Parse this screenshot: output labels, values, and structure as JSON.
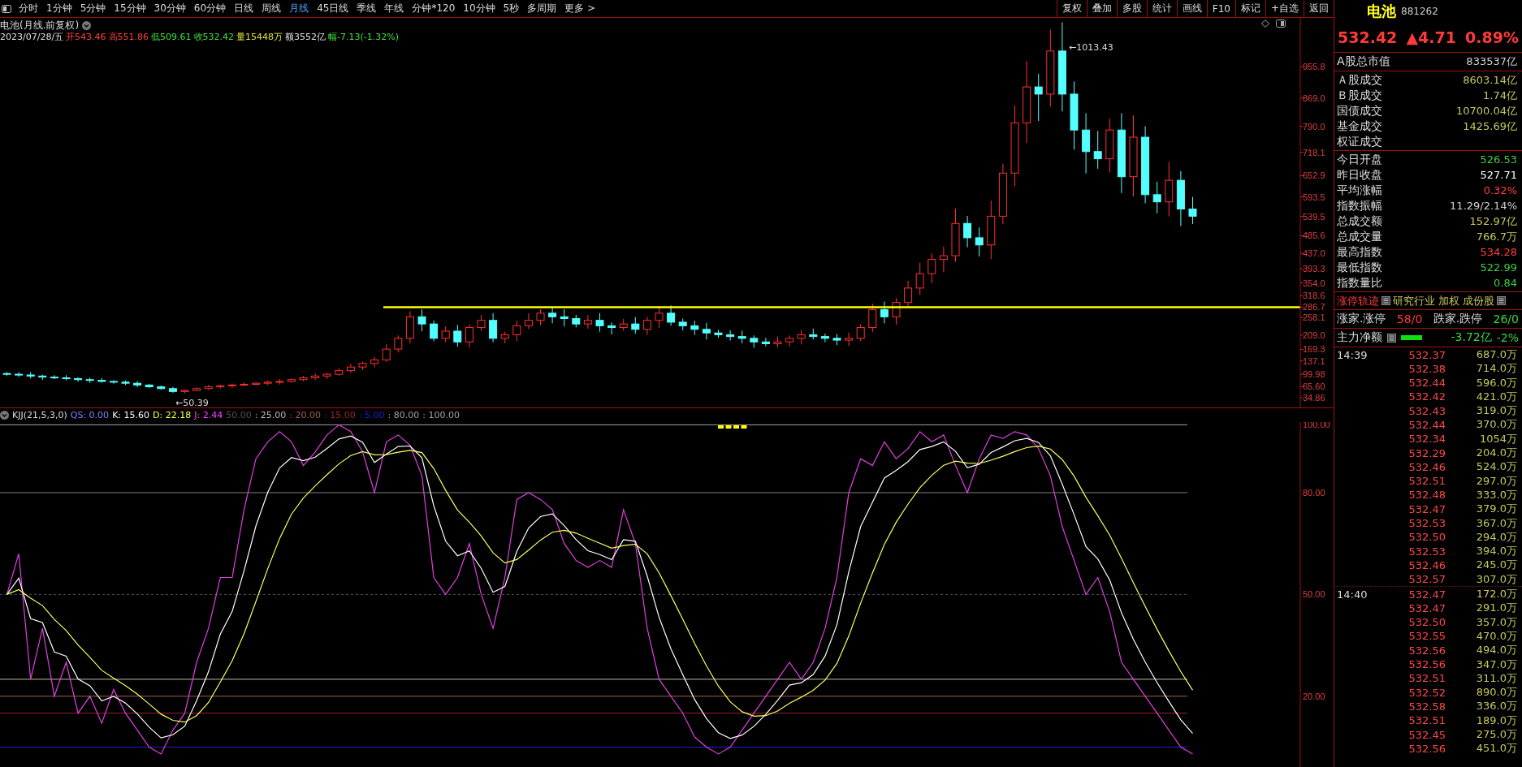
{
  "toolbar": {
    "periods": [
      {
        "label": "分时",
        "selected": false
      },
      {
        "label": "1分钟",
        "selected": false
      },
      {
        "label": "5分钟",
        "selected": false
      },
      {
        "label": "15分钟",
        "selected": false
      },
      {
        "label": "30分钟",
        "selected": false
      },
      {
        "label": "60分钟",
        "selected": false
      },
      {
        "label": "日线",
        "selected": false
      },
      {
        "label": "周线",
        "selected": false
      },
      {
        "label": "月线",
        "selected": true
      },
      {
        "label": "45日线",
        "selected": false
      },
      {
        "label": "季线",
        "selected": false
      },
      {
        "label": "年线",
        "selected": false
      },
      {
        "label": "分钟*120",
        "selected": false
      },
      {
        "label": "10分钟",
        "selected": false
      },
      {
        "label": "5秒",
        "selected": false
      },
      {
        "label": "多周期",
        "selected": false
      },
      {
        "label": "更多 >",
        "selected": false
      }
    ],
    "actions": [
      "复权",
      "叠加",
      "多股",
      "统计",
      "画线",
      "F10",
      "标记",
      "+自选",
      "返回"
    ]
  },
  "chart": {
    "title": "电池(月线.前复权)",
    "quote": [
      {
        "text": "2023/07/28/五",
        "color": "#e0e0e0"
      },
      {
        "text": "开543.46",
        "color": "#ff4040"
      },
      {
        "text": "高551.86",
        "color": "#ff4040"
      },
      {
        "text": "低509.61",
        "color": "#40e040"
      },
      {
        "text": "收532.42",
        "color": "#40e040"
      },
      {
        "text": "量15448万",
        "color": "#e0e040"
      },
      {
        "text": "额3552亿",
        "color": "#e0e0e0"
      },
      {
        "text": "幅-7.13(-1.32%)",
        "color": "#40e040"
      }
    ],
    "price_ticks": [
      "955.8",
      "869.0",
      "790.0",
      "718.1",
      "652.9",
      "593.5",
      "539.5",
      "485.6",
      "437.0",
      "393.3",
      "354.0",
      "318.6",
      "286.7",
      "258.1",
      "209.0",
      "169.3",
      "137.1",
      "99.98",
      "65.60",
      "34.86"
    ],
    "high_label": "←1013.43",
    "low_label": "←50.39"
  },
  "indicator": {
    "name": "KJJ(21,5,3,0)",
    "values": [
      {
        "text": "QS: 0.00",
        "color": "#8080ff"
      },
      {
        "text": "K: 15.60",
        "color": "#ffffff"
      },
      {
        "text": "D: 22.18",
        "color": "#ffff40"
      },
      {
        "text": "J: 2.44",
        "color": "#ff40ff"
      },
      {
        "text": "50.00",
        "color": "#505050"
      },
      {
        "text": ": 25.00",
        "color": "#c8b8a8"
      },
      {
        "text": ": 20.00",
        "color": "#a06050"
      },
      {
        "text": ": 15.00",
        "color": "#a02030"
      },
      {
        "text": ": 5.00",
        "color": "#2020d0"
      },
      {
        "text": ": 80.00",
        "color": "#a0a0a0"
      },
      {
        "text": ": 100.00",
        "color": "#a0a0a0"
      }
    ],
    "ticks": [
      "100.00",
      "80.00",
      "50.00",
      "20.00"
    ]
  },
  "quote_panel": {
    "name": "电池",
    "code": "881262",
    "price": "532.42",
    "change": "▲4.71",
    "percent": "0.89%",
    "market_cap": {
      "label": "A股总市值",
      "value": "833537亿",
      "color": "#d0d0d0"
    },
    "groups": [
      [
        {
          "label": "Ａ股成交",
          "value": "8603.14亿",
          "color": "#c8c860"
        },
        {
          "label": "Ｂ股成交",
          "value": "1.74亿",
          "color": "#c8c860"
        },
        {
          "label": "国债成交",
          "value": "10700.04亿",
          "color": "#c8c860"
        },
        {
          "label": "基金成交",
          "value": "1425.69亿",
          "color": "#c8c860"
        },
        {
          "label": "权证成交"
        }
      ],
      [
        {
          "label": "今日开盘",
          "value": "526.53",
          "color": "#40d040"
        },
        {
          "label": "昨日收盘",
          "value": "527.71",
          "color": "#ffffff"
        },
        {
          "label": "平均涨幅",
          "value": "0.32%",
          "color": "#ff4040"
        },
        {
          "label": "指数振幅",
          "value": "11.29/2.14%",
          "color": "#d0d0d0"
        },
        {
          "label": "总成交额",
          "value": "152.97亿",
          "color": "#c8c860"
        },
        {
          "label": "总成交量",
          "value": "766.7万",
          "color": "#c8c860"
        },
        {
          "label": "最高指数",
          "value": "534.28",
          "color": "#ff4040"
        },
        {
          "label": "最低指数",
          "value": "522.99",
          "color": "#40d040"
        },
        {
          "label": "指数量比",
          "value": "0.84",
          "color": "#40d040"
        }
      ]
    ],
    "limit_track": "涨停轨迹",
    "research_links": "研究行业 加权 成份股",
    "breadth": {
      "up_label": "涨家.涨停",
      "up": "58/0",
      "down_label": "跌家.跌停",
      "down": "26/0"
    },
    "flow": {
      "label": "主力净额",
      "value": "-3.72亿",
      "percent": "-2%"
    },
    "ticks": [
      {
        "time": "14:39",
        "price": "532.37",
        "volume": "687.0万"
      },
      {
        "price": "532.38",
        "volume": "714.0万"
      },
      {
        "price": "532.44",
        "volume": "596.0万"
      },
      {
        "price": "532.42",
        "volume": "421.0万"
      },
      {
        "price": "532.43",
        "volume": "319.0万"
      },
      {
        "price": "532.44",
        "volume": "370.0万"
      },
      {
        "price": "532.34",
        "volume": "1054万"
      },
      {
        "price": "532.29",
        "volume": "204.0万"
      },
      {
        "price": "532.46",
        "volume": "524.0万"
      },
      {
        "price": "532.51",
        "volume": "297.0万"
      },
      {
        "price": "532.48",
        "volume": "333.0万"
      },
      {
        "price": "532.47",
        "volume": "379.0万"
      },
      {
        "price": "532.53",
        "volume": "367.0万"
      },
      {
        "price": "532.50",
        "volume": "294.0万"
      },
      {
        "price": "532.53",
        "volume": "394.0万"
      },
      {
        "price": "532.46",
        "volume": "245.0万"
      },
      {
        "price": "532.57",
        "volume": "307.0万"
      },
      {
        "time": "14:40",
        "price": "532.47",
        "volume": "172.0万"
      },
      {
        "price": "532.47",
        "volume": "291.0万"
      },
      {
        "price": "532.50",
        "volume": "357.0万"
      },
      {
        "price": "532.55",
        "volume": "470.0万"
      },
      {
        "price": "532.56",
        "volume": "494.0万"
      },
      {
        "price": "532.56",
        "volume": "347.0万"
      },
      {
        "price": "532.51",
        "volume": "311.0万"
      },
      {
        "price": "532.52",
        "volume": "890.0万"
      },
      {
        "price": "532.58",
        "volume": "336.0万"
      },
      {
        "price": "532.51",
        "volume": "189.0万"
      },
      {
        "price": "532.45",
        "volume": "275.0万"
      },
      {
        "price": "532.56",
        "volume": "451.0万"
      }
    ]
  }
}
